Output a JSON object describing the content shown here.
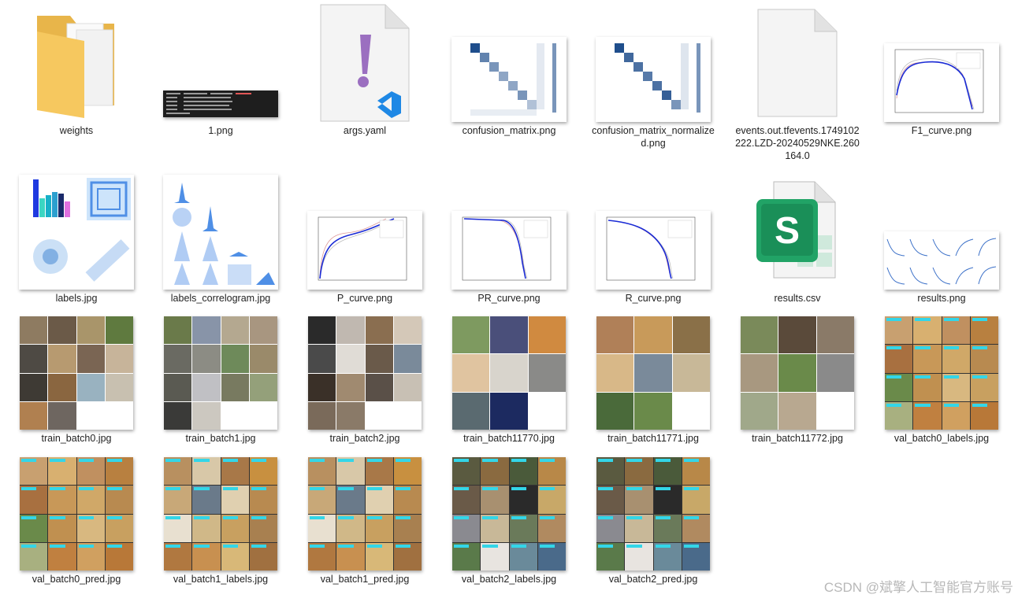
{
  "files": [
    {
      "name": "weights",
      "kind": "folder"
    },
    {
      "name": "1.png",
      "kind": "terminal"
    },
    {
      "name": "args.yaml",
      "kind": "yaml"
    },
    {
      "name": "confusion_matrix.png",
      "kind": "matrix"
    },
    {
      "name": "confusion_matrix_normalized.png",
      "kind": "matrix"
    },
    {
      "name": "events.out.tfevents.1749102222.LZD-20240529NKE.260164.0",
      "kind": "blank-file"
    },
    {
      "name": "F1_curve.png",
      "kind": "curve"
    },
    {
      "name": "labels.jpg",
      "kind": "labels"
    },
    {
      "name": "labels_correlogram.jpg",
      "kind": "correlogram"
    },
    {
      "name": "P_curve.png",
      "kind": "curve"
    },
    {
      "name": "PR_curve.png",
      "kind": "curve"
    },
    {
      "name": "R_curve.png",
      "kind": "curve"
    },
    {
      "name": "results.csv",
      "kind": "csv"
    },
    {
      "name": "results.png",
      "kind": "results"
    },
    {
      "name": "train_batch0.jpg",
      "kind": "batch"
    },
    {
      "name": "train_batch1.jpg",
      "kind": "batch"
    },
    {
      "name": "train_batch2.jpg",
      "kind": "batch"
    },
    {
      "name": "train_batch11770.jpg",
      "kind": "batch"
    },
    {
      "name": "train_batch11771.jpg",
      "kind": "batch"
    },
    {
      "name": "train_batch11772.jpg",
      "kind": "batch"
    },
    {
      "name": "val_batch0_labels.jpg",
      "kind": "val"
    },
    {
      "name": "val_batch0_pred.jpg",
      "kind": "val"
    },
    {
      "name": "val_batch1_labels.jpg",
      "kind": "val"
    },
    {
      "name": "val_batch1_pred.jpg",
      "kind": "val"
    },
    {
      "name": "val_batch2_labels.jpg",
      "kind": "val"
    },
    {
      "name": "val_batch2_pred.jpg",
      "kind": "val"
    }
  ],
  "csv_icon_letter": "S",
  "watermark": "CSDN @斌擎人工智能官方账号",
  "colors": {
    "folder": "#f6c85f",
    "vscode": "#1e88e5",
    "yaml_mark": "#9b6fc0",
    "csv_green": "#21a366",
    "matrix_blue": "#1f4e8c",
    "dog_brown": "#b7863f"
  }
}
